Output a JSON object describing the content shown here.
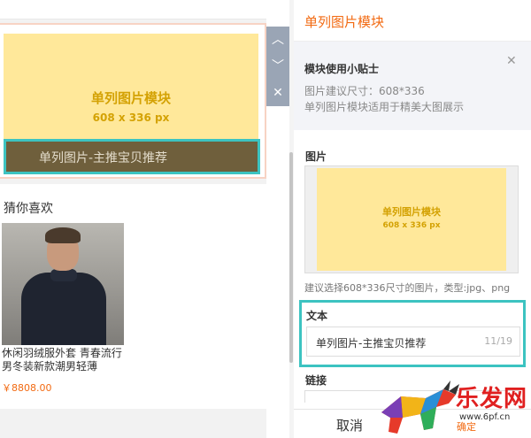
{
  "preview": {
    "module": {
      "placeholder_title": "单列图片模块",
      "placeholder_size": "608 x 336 px",
      "caption": "单列图片-主推宝贝推荐"
    },
    "guess_like": {
      "title": "猜你喜欢",
      "product": {
        "name": "休闲羽绒服外套 青春流行男冬装新款潮男轻薄",
        "price": "￥8808.00"
      }
    },
    "side_tools": {
      "up_icon": "︿",
      "down_icon": "﹀",
      "close_icon": "✕"
    }
  },
  "panel": {
    "title": "单列图片模块",
    "tips": {
      "title": "模块使用小贴士",
      "close_icon": "✕",
      "line1": "图片建议尺寸：608*336",
      "line2": "单列图片模块适用于精美大图展示"
    },
    "image": {
      "label": "图片",
      "placeholder_title": "单列图片模块",
      "placeholder_size": "608 x 336 px",
      "hint": "建议选择608*336尺寸的图片，类型:jpg、png"
    },
    "text": {
      "label": "文本",
      "value": "单列图片-主推宝贝推荐",
      "count": "11/19"
    },
    "link": {
      "label": "链接"
    },
    "footer": {
      "cancel": "取消",
      "confirm": "确定"
    }
  },
  "watermark": {
    "title": "乐发网",
    "url": "www.6pf.cn"
  },
  "colors": {
    "accent": "#f26a12",
    "highlight": "#3cc3c1",
    "placeholder_bg": "#ffe89a",
    "placeholder_text": "#d4a204"
  }
}
